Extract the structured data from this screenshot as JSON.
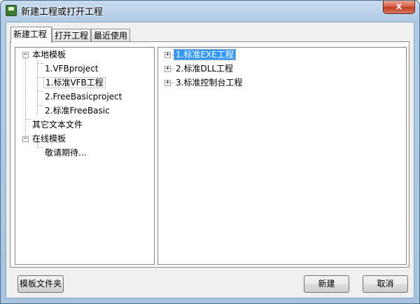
{
  "window": {
    "title": "新建工程或打开工程",
    "close_label": "x"
  },
  "tabs": [
    {
      "label": "新建工程",
      "active": true
    },
    {
      "label": "打开工程",
      "active": false
    },
    {
      "label": "最近使用",
      "active": false
    }
  ],
  "left_tree": {
    "root1": {
      "label": "本地模板",
      "expander": "−"
    },
    "items": [
      "1.VFBproject",
      "1.标准VFB工程",
      "2.FreeBasicproject",
      "2.标准FreeBasic"
    ],
    "other": "其它文本文件",
    "root2": {
      "label": "在线模板",
      "expander": "−"
    },
    "online_items": [
      "敬请期待..."
    ]
  },
  "right_tree": {
    "items": [
      {
        "label": "1.标准EXE工程",
        "expander": "+",
        "selected": true
      },
      {
        "label": "2.标准DLL工程",
        "expander": "+",
        "selected": false
      },
      {
        "label": "3.标准控制台工程",
        "expander": "+",
        "selected": false
      }
    ]
  },
  "buttons": {
    "template_folder": "模板文件夹",
    "new": "新建",
    "cancel": "取消"
  }
}
